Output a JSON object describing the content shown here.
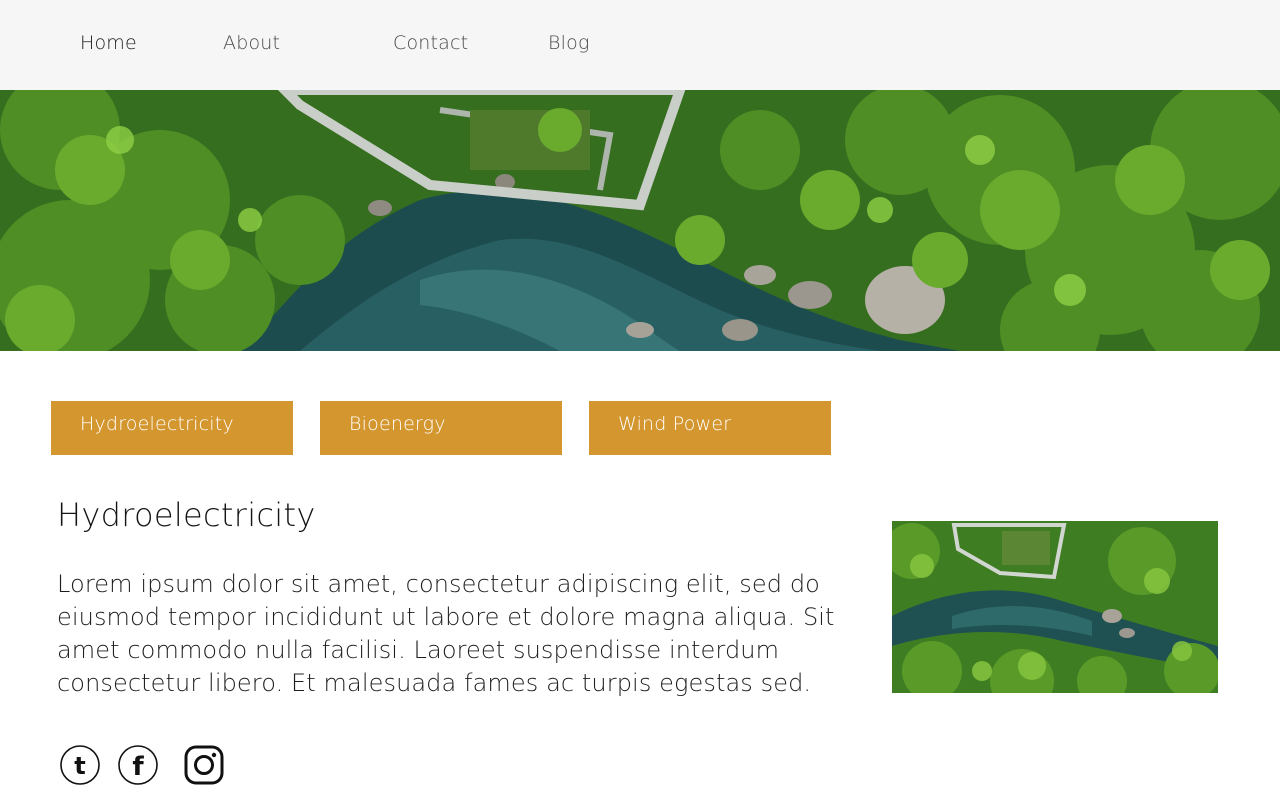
{
  "nav": {
    "items": [
      {
        "label": "Home",
        "active": true
      },
      {
        "label": "About",
        "active": false
      },
      {
        "label": "Contact",
        "active": false
      },
      {
        "label": "Blog",
        "active": false
      }
    ]
  },
  "hero": {
    "image": "aerial view of river through forest with ruined building"
  },
  "tabs": [
    {
      "label": "Hydroelectricity"
    },
    {
      "label": "Bioenergy"
    },
    {
      "label": "Wind Power"
    }
  ],
  "content": {
    "title": "Hydroelectricity",
    "body": "Lorem ipsum dolor sit amet, consectetur adipiscing elit, sed do eiusmod tempor incididunt ut labore et dolore magna aliqua. Sit amet commodo nulla facilisi. Laoreet suspendisse interdum consectetur libero. Et malesuada fames ac turpis egestas sed."
  },
  "social": [
    {
      "icon": "tumblr-icon"
    },
    {
      "icon": "facebook-icon"
    },
    {
      "icon": "instagram-icon"
    }
  ],
  "colors": {
    "accent": "#d4962e",
    "nav_bg": "#f6f6f6"
  }
}
